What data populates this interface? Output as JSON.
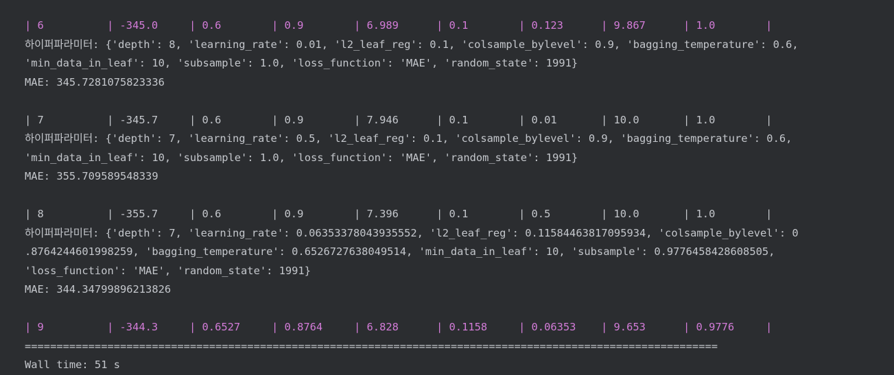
{
  "output": {
    "row6": {
      "cells": [
        "| 6",
        "| -345.0",
        "| 0.6",
        "| 0.9",
        "| 6.989",
        "| 0.1",
        "| 0.123",
        "| 9.867",
        "| 1.0",
        "|"
      ],
      "highlighted": true
    },
    "params6_line1": "하이퍼파라미터: {'depth': 8, 'learning_rate': 0.01, 'l2_leaf_reg': 0.1, 'colsample_bylevel': 0.9, 'bagging_temperature': 0.6,",
    "params6_line2": "'min_data_in_leaf': 10, 'subsample': 1.0, 'loss_function': 'MAE', 'random_state': 1991}",
    "mae6": "MAE: 345.7281075823336",
    "row7": {
      "cells": [
        "| 7",
        "| -345.7",
        "| 0.6",
        "| 0.9",
        "| 7.946",
        "| 0.1",
        "| 0.01",
        "| 10.0",
        "| 1.0",
        "|"
      ],
      "highlighted": false
    },
    "params7_line1": "하이퍼파라미터: {'depth': 7, 'learning_rate': 0.5, 'l2_leaf_reg': 0.1, 'colsample_bylevel': 0.9, 'bagging_temperature': 0.6,",
    "params7_line2": "'min_data_in_leaf': 10, 'subsample': 1.0, 'loss_function': 'MAE', 'random_state': 1991}",
    "mae7": "MAE: 355.709589548339",
    "row8": {
      "cells": [
        "| 8",
        "| -355.7",
        "| 0.6",
        "| 0.9",
        "| 7.396",
        "| 0.1",
        "| 0.5",
        "| 10.0",
        "| 1.0",
        "|"
      ],
      "highlighted": false
    },
    "params8_line1": "하이퍼파라미터: {'depth': 7, 'learning_rate': 0.06353378043935552, 'l2_leaf_reg': 0.11584463817095934, 'colsample_bylevel': 0",
    "params8_line2": ".8764244601998259, 'bagging_temperature': 0.6526727638049514, 'min_data_in_leaf': 10, 'subsample': 0.9776458428608505,",
    "params8_line3": "'loss_function': 'MAE', 'random_state': 1991}",
    "mae8": "MAE: 344.34799896213826",
    "row9": {
      "cells": [
        "| 9",
        "| -344.3",
        "| 0.6527",
        "| 0.8764",
        "| 6.828",
        "| 0.1158",
        "| 0.06353",
        "| 9.653",
        "| 0.9776",
        "|"
      ],
      "highlighted": true
    },
    "separator": "=============================================================================================================",
    "wall_time": "Wall time: 51 s"
  },
  "colors": {
    "background": "#2b2d30",
    "text": "#c4c7cc",
    "highlight": "#d37cd8"
  }
}
